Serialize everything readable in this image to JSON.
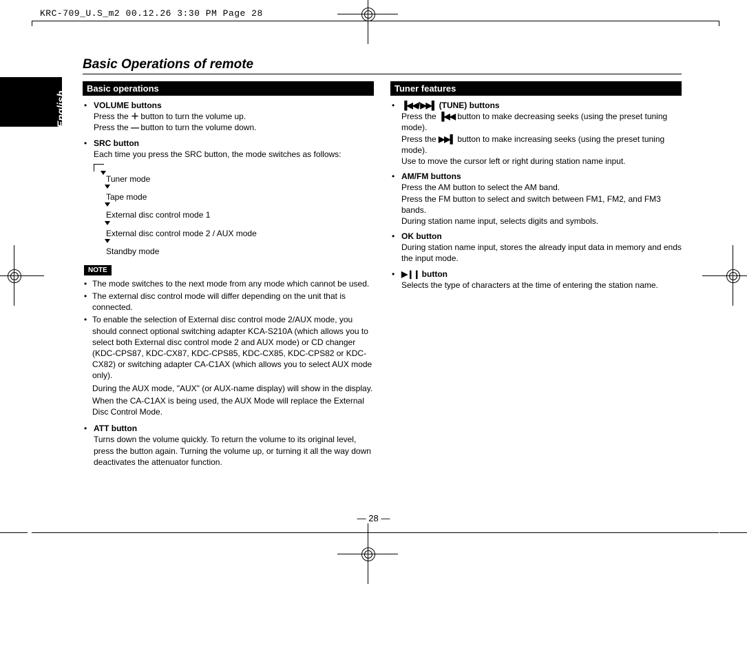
{
  "header": "KRC-709_U.S_m2  00.12.26 3:30 PM  Page 28",
  "language_tab": "English",
  "page_title": "Basic Operations of remote",
  "page_number": "— 28 —",
  "glyphs": {
    "plus": "＋",
    "minus": "—",
    "rew": "▐◀◀",
    "fwd": "▶▶▌",
    "playpause": "▶❙❙"
  },
  "left": {
    "bar": "Basic operations",
    "items": [
      {
        "title": "VOLUME buttons",
        "lines": [
          {
            "pre": "Press the ",
            "g": "plus",
            "post": " button to turn the volume up."
          },
          {
            "pre": "Press the ",
            "g": "minus",
            "post": " button to turn the volume down."
          }
        ]
      },
      {
        "title": "SRC button",
        "plain": "Each time you press the SRC button, the mode switches as follows:"
      }
    ],
    "flow": [
      "Tuner mode",
      "Tape mode",
      "External disc control mode 1",
      "External disc control mode 2 / AUX mode",
      "Standby mode"
    ],
    "note_label": "NOTE",
    "notes": [
      "The mode switches to the next mode from any mode which cannot be used.",
      "The external disc control mode will differ depending on the unit that is connected.",
      "To enable the selection of External disc control mode 2/AUX mode, you should connect optional switching adapter KCA-S210A (which allows you to select both External disc control mode 2 and AUX mode) or CD changer (KDC-CPS87, KDC-CX87, KDC-CPS85, KDC-CX85, KDC-CPS82 or KDC-CX82) or switching adapter CA-C1AX (which allows you to select AUX mode only)."
    ],
    "note3_extra": [
      "During the AUX mode, \"AUX\" (or AUX-name display) will show in the display.",
      "When the CA-C1AX is being used, the AUX Mode will replace the External Disc Control Mode."
    ],
    "att": {
      "title": "ATT button",
      "desc": "Turns down the volume quickly. To return the volume to its original level, press the button again. Turning the volume up, or turning it all the way down deactivates the attenuator function."
    }
  },
  "right": {
    "bar": "Tuner features",
    "items": [
      {
        "title_glyph_pre": "",
        "title_g1": "rew",
        "title_mid": "/",
        "title_g2": "fwd",
        "title_post": " (TUNE) buttons",
        "lines": [
          {
            "pre": "Press the ",
            "g": "rew",
            "post": " button to make decreasing seeks (using the preset tuning mode)."
          },
          {
            "pre": "Press the ",
            "g": "fwd",
            "post": " button to make increasing seeks (using the preset tuning mode)."
          },
          {
            "plain": "Use to move the cursor left or right during station name input."
          }
        ]
      },
      {
        "title": "AM/FM buttons",
        "plain_lines": [
          "Press the AM button to select the AM band.",
          "Press the FM button to select and switch between FM1, FM2, and FM3 bands.",
          "During station name input, selects digits and symbols."
        ]
      },
      {
        "title": "OK button",
        "plain": "During station name input, stores the already input data in memory and ends the input mode."
      },
      {
        "title_g": "playpause",
        "title_post_g": " button",
        "plain": "Selects the type of characters at the time of entering the station name."
      }
    ]
  }
}
